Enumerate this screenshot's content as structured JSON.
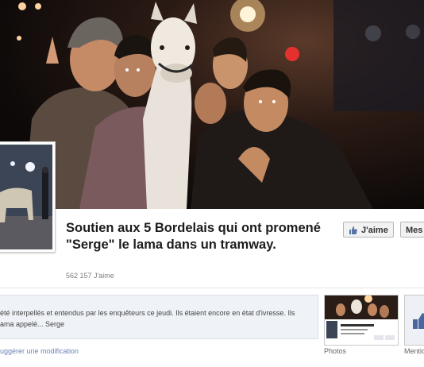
{
  "page": {
    "title": "Soutien aux 5 Bordelais qui ont promené \"Serge\" le lama dans un tramway.",
    "likes": "562 157 J'aime"
  },
  "actions": {
    "like_label": "J'aime",
    "message_label": "Mes"
  },
  "about": {
    "line1": "été interpellés et entendus par les enquêteurs ce jeudi. Ils étaient encore en état d'ivresse. Ils",
    "line2": "ama appelé... Serge"
  },
  "links": {
    "suggest_edit": "uggérer une modification",
    "photos": "Photos",
    "mentions": "Mentio"
  },
  "icons": [
    "thumbs-up-icon"
  ],
  "colors": {
    "link": "#6d84b4",
    "title": "#1c1c1c",
    "about_bg": "#eff2f7"
  }
}
